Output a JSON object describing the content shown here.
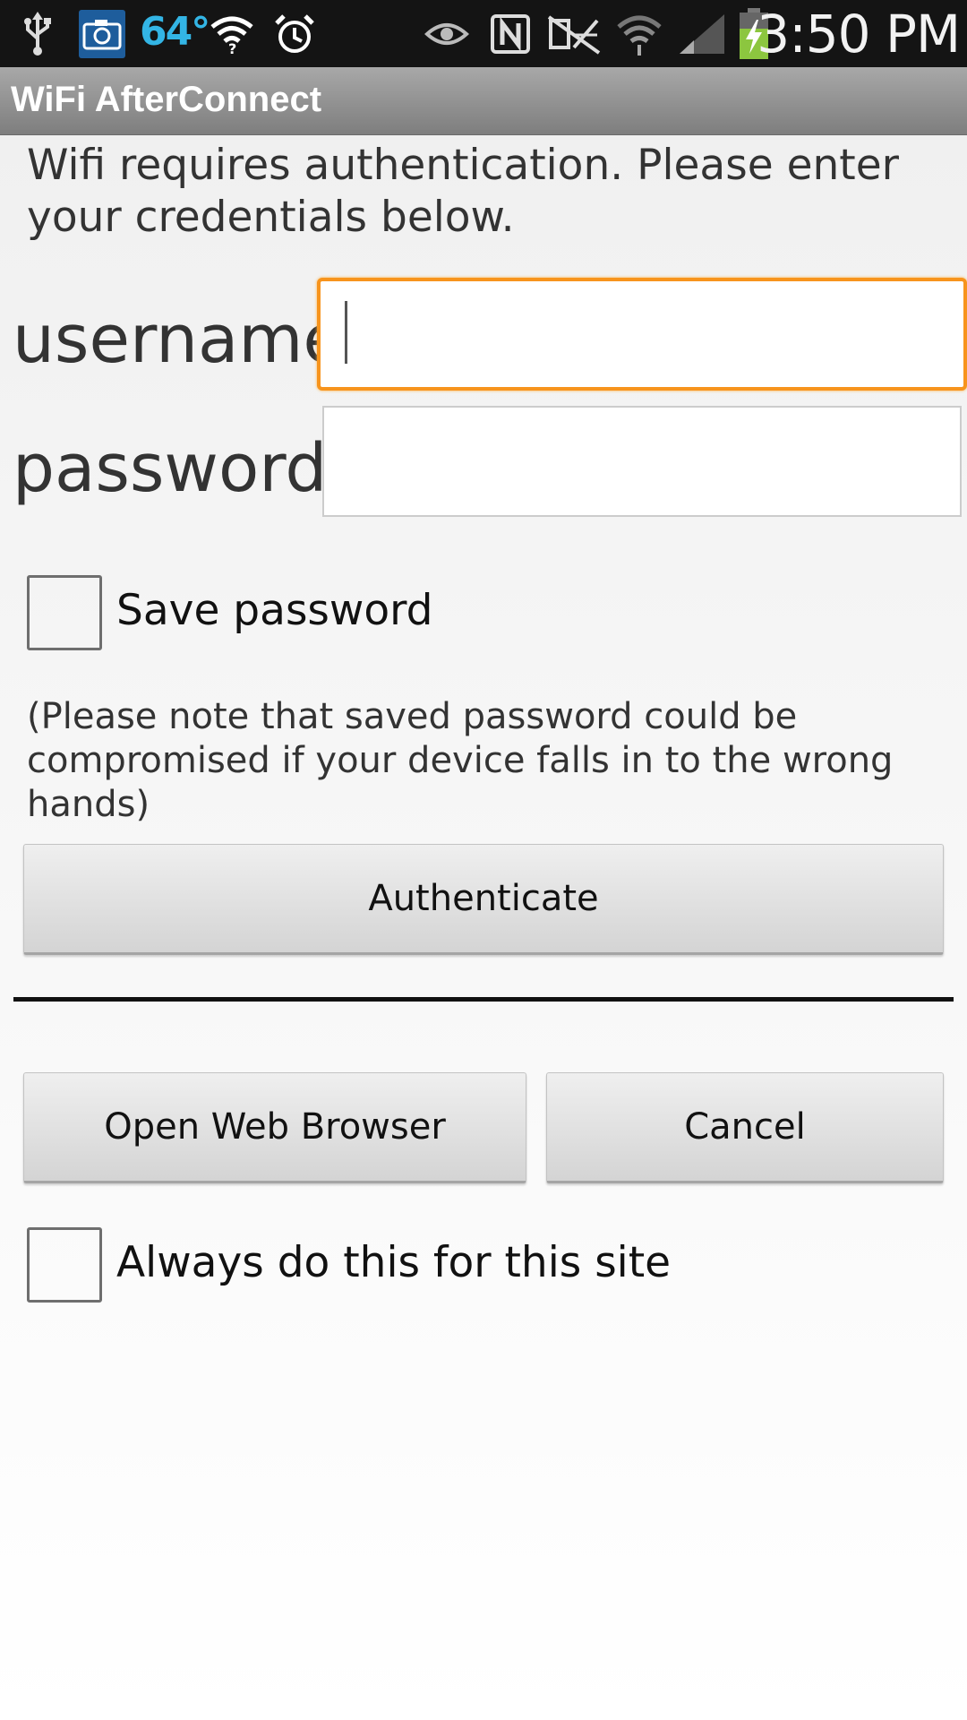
{
  "status_bar": {
    "temperature": "64°",
    "time": "3:50 PM",
    "icons": [
      "usb-icon",
      "camera-icon",
      "wifi-question-icon",
      "alarm-icon",
      "eye-icon",
      "nfc-icon",
      "no-sim-icon",
      "wifi-icon",
      "signal-icon",
      "battery-charging-icon"
    ]
  },
  "title_bar": {
    "title": "WiFi AfterConnect"
  },
  "form": {
    "intro": "Wifi requires authentication. Please enter your credentials below.",
    "username_label": "username",
    "username_value": "",
    "password_label": "password",
    "password_value": "",
    "save_password_label": "Save password",
    "save_password_checked": false,
    "note": "(Please note that saved password could be compromised if your device falls in to the wrong hands)",
    "authenticate_label": "Authenticate"
  },
  "actions": {
    "open_browser_label": "Open Web Browser",
    "cancel_label": "Cancel",
    "always_label": "Always do this for this site",
    "always_checked": false
  },
  "colors": {
    "focus_border": "#f7941d",
    "temp_accent": "#33b5e5",
    "battery_fill": "#8cc63f"
  }
}
